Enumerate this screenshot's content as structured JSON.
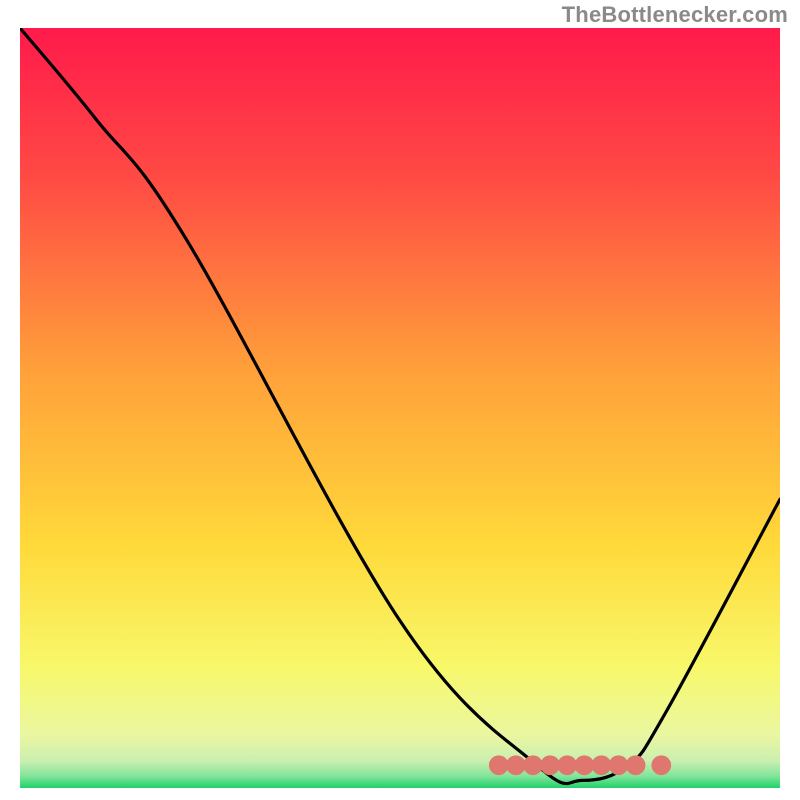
{
  "attribution": "TheBottlenecker.com",
  "chart_data": {
    "type": "line",
    "title": "",
    "xlabel": "",
    "ylabel": "",
    "xlim": [
      0,
      100
    ],
    "ylim": [
      0,
      100
    ],
    "grid": false,
    "series": [
      {
        "name": "curve",
        "color": "#000000",
        "x": [
          0,
          10,
          22,
          50,
          68,
          74,
          80,
          85,
          100
        ],
        "y": [
          100,
          88,
          72,
          22,
          3,
          1,
          3,
          10,
          38
        ]
      }
    ],
    "marker_band": {
      "color": "#e0776e",
      "x_center": 72,
      "x_half_width": 9,
      "y": 3,
      "thickness": 2.6
    },
    "background_gradient": {
      "stops": [
        {
          "offset": 0.0,
          "color": "#ff1a4b"
        },
        {
          "offset": 0.2,
          "color": "#ff4b44"
        },
        {
          "offset": 0.45,
          "color": "#ffa03a"
        },
        {
          "offset": 0.68,
          "color": "#ffd93a"
        },
        {
          "offset": 0.84,
          "color": "#f8f86a"
        },
        {
          "offset": 0.93,
          "color": "#eaf7a0"
        },
        {
          "offset": 0.965,
          "color": "#c9efb0"
        },
        {
          "offset": 0.985,
          "color": "#7fe49a"
        },
        {
          "offset": 1.0,
          "color": "#20d069"
        }
      ]
    }
  }
}
